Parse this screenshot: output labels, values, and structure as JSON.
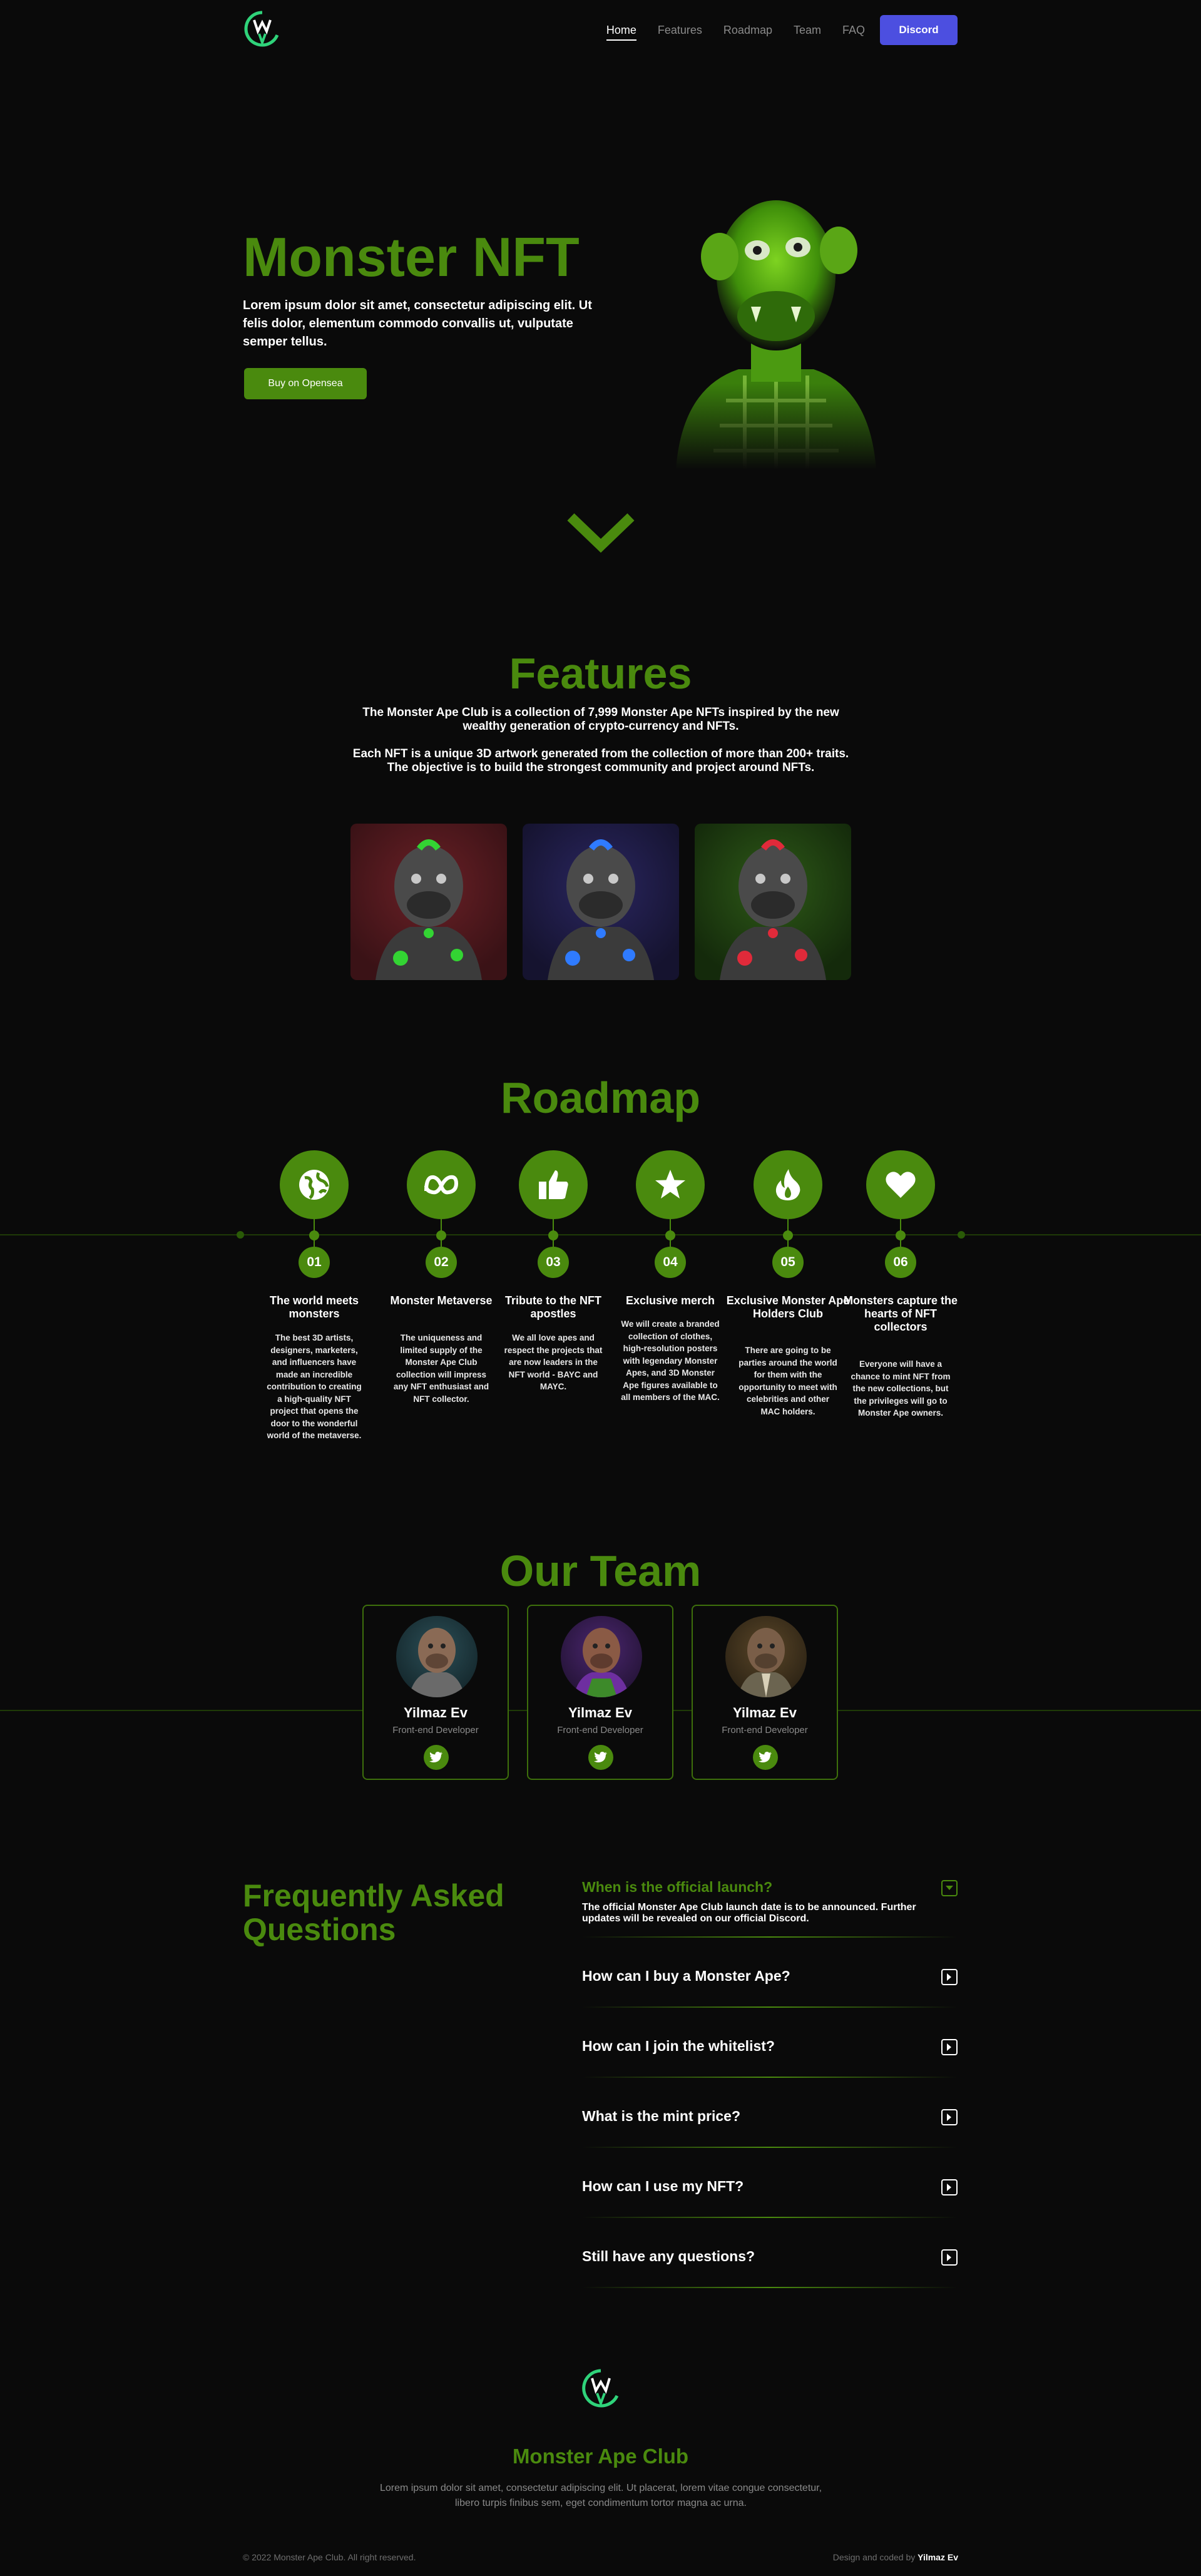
{
  "nav": {
    "links": [
      {
        "label": "Home",
        "active": true
      },
      {
        "label": "Features",
        "active": false
      },
      {
        "label": "Roadmap",
        "active": false
      },
      {
        "label": "Team",
        "active": false
      },
      {
        "label": "FAQ",
        "active": false
      }
    ],
    "discord_label": "Discord"
  },
  "hero": {
    "title": "Monster NFT",
    "text": "Lorem ipsum dolor sit amet, consectetur adipiscing elit. Ut felis dolor, elementum commodo convallis ut, vulputate semper tellus.",
    "button_label": "Buy on Opensea"
  },
  "features": {
    "title": "Features",
    "paragraph_1": "The Monster Ape Club is a collection of 7,999 Monster Ape NFTs inspired by the new wealthy generation of crypto-currency and NFTs.",
    "paragraph_2": "Each NFT is a unique 3D artwork generated from the collection of more than 200+ traits. The objective is to build the strongest community and project around NFTs."
  },
  "roadmap": {
    "title": "Roadmap",
    "items": [
      {
        "num": "01",
        "icon": "globe-icon",
        "title": "The world meets monsters",
        "desc": "The best 3D artists, designers, marketers, and influencers have made an incredible contribution to creating a high-quality NFT project that opens the door to the wonderful world of the metaverse."
      },
      {
        "num": "02",
        "icon": "meta-icon",
        "title": "Monster Metaverse",
        "desc": "The uniqueness and limited supply of the Monster Ape Club collection will impress any NFT enthusiast and NFT collector."
      },
      {
        "num": "03",
        "icon": "thumbs-up-icon",
        "title": "Tribute to the NFT apostles",
        "desc": "We all love apes and respect the projects that are now leaders in the NFT world - BAYC and MAYC."
      },
      {
        "num": "04",
        "icon": "star-icon",
        "title": "Exclusive merch",
        "desc": "We will create a branded collection of clothes, high-resolution posters with legendary Monster Apes, and 3D Monster Ape figures available to all members of the MAC."
      },
      {
        "num": "05",
        "icon": "fire-icon",
        "title": "Exclusive Monster Ape Holders Club",
        "desc": "There are going to be parties around the world for them with the opportunity to meet with celebrities and other MAC holders."
      },
      {
        "num": "06",
        "icon": "heart-icon",
        "title": "Monsters capture the hearts of NFT collectors",
        "desc": "Everyone will have a chance to mint NFT from the new collections, but the privileges will go to Monster Ape owners."
      }
    ]
  },
  "team": {
    "title": "Our Team",
    "members": [
      {
        "name": "Yilmaz Ev",
        "role": "Front-end Developer"
      },
      {
        "name": "Yilmaz Ev",
        "role": "Front-end Developer"
      },
      {
        "name": "Yilmaz Ev",
        "role": "Front-end Developer"
      }
    ]
  },
  "faq": {
    "title": "Frequently Asked Questions",
    "items": [
      {
        "question": "When is the official launch?",
        "answer": "The official Monster Ape Club launch date is to be announced. Further updates will be revealed on our official Discord.",
        "open": true
      },
      {
        "question": "How can I buy a Monster Ape?",
        "answer": "",
        "open": false
      },
      {
        "question": "How can I join the whitelist?",
        "answer": "",
        "open": false
      },
      {
        "question": "What is the mint price?",
        "answer": "",
        "open": false
      },
      {
        "question": "How can I use my NFT?",
        "answer": "",
        "open": false
      },
      {
        "question": "Still have any questions?",
        "answer": "",
        "open": false
      }
    ]
  },
  "footer": {
    "brand": "Monster Ape Club",
    "text": "Lorem ipsum dolor sit amet, consectetur adipiscing elit. Ut placerat, lorem vitae congue consectetur, libero turpis finibus sem, eget condimentum tortor magna ac urna.",
    "copyright": "© 2022 Monster Ape Club. All right reserved.",
    "credit_prefix": "Design and coded by",
    "credit_name": "Yilmaz Ev"
  },
  "colors": {
    "accent": "#4a8a0e",
    "discord": "#4c4fe0",
    "background": "#0a0a0a"
  }
}
